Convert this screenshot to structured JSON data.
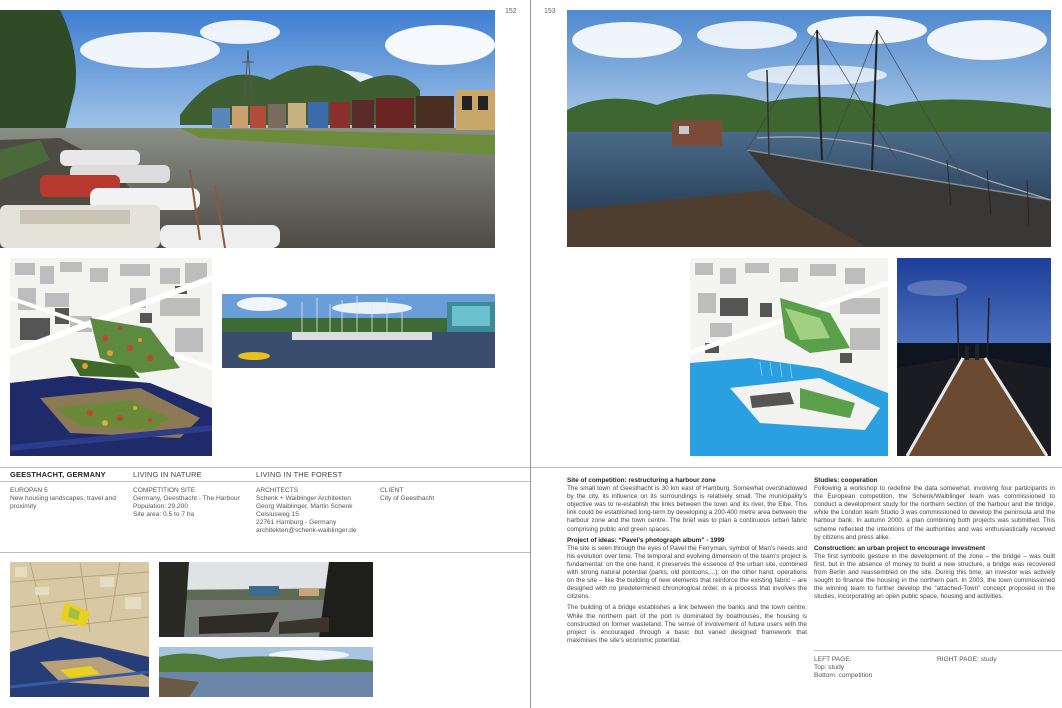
{
  "left_page": {
    "page_number": "152",
    "info": {
      "headers": [
        "GEESTHACHT, GERMANY",
        "LIVING IN NATURE",
        "LIVING IN THE FOREST"
      ],
      "europan": {
        "label": "EUROPAN 5",
        "text": "New housing landscapes, travel and proximity"
      },
      "site": {
        "label": "COMPETITION SITE",
        "lines": [
          "Germany, Geesthacht - The Harbour",
          "Population: 29,200",
          "Site area: 0.5 to 7 ha"
        ]
      },
      "architects": {
        "label": "ARCHITECTS",
        "lines": [
          "Schenk + Waiblinger Architekten",
          "Georg Waiblinger, Martin Schenk",
          "Celsiusweg 15",
          "22761 Hamburg - Germany",
          "architekten@schenk-waiblinger.de"
        ]
      },
      "client": {
        "label": "CLIENT",
        "text": "City of Geesthacht"
      }
    }
  },
  "right_page": {
    "page_number": "153",
    "col1": [
      {
        "heading": "Site of competition: restructuring a harbour zone",
        "paragraphs": [
          "The small town of Geesthacht is 30 km east of Hamburg. Somewhat overshadowed by the city, its influence on its surroundings is relatively small. The municipality’s objective was to re-establish the links between the town and its river, the Elbe. This link could be established long-term by developing a 200-400 metre area between the harbour zone and the town centre. The brief was to plan a continuous urban fabric comprising public and green spaces."
        ]
      },
      {
        "heading": "Project of ideas: “Pavel’s photograph album” - 1999",
        "paragraphs": [
          "The site is seen through the eyes of Pavel the Ferryman, symbol of Man’s needs and his evolution over time. The temporal and evolving dimension of the team’s project is fundamental: on the one hand, it preserves the essence of the urban site, combined with strong natural potential (parks, old pontoons,...); on the other hand, operations on the site – like the building of new elements that reinforce the existing fabric – are designed with no predetermined chronological order, in a process that involves the citizens.",
          "The building of a bridge establishes a link between the banks and the town centre. While the northern part of the port is dominated by boathouses, the housing is constructed on former wasteland. The sense of involvement of future users with the project is encouraged through a basic but varied designed framework that maximises the site’s economic potential."
        ]
      }
    ],
    "col2": [
      {
        "heading": "Studies: cooperation",
        "paragraphs": [
          "Following a workshop to redefine the data somewhat, involving four participants in the European competition, the Schenk/Waiblinger team was commissioned to conduct a development study for the northern section of the harbour and the bridge, while the London team Studio 3 was commissioned to develop the peninsula and the harbour bank. In autumn 2000, a plan combining both projects was submitted. This scheme reflected the intentions of the authorities and was enthusiastically received by citizens and press alike."
        ]
      },
      {
        "heading": "Construction: an urban project to encourage investment",
        "paragraphs": [
          "The first symbolic gesture in the development of the zone – the bridge – was built first, but in the absence of money to build a new structure, a bridge was recovered from Berlin and reassembled on the site. During this time, an investor was actively sought to finance the housing in the northern part. In 2003, the town commissioned the winning team to further develop the “attached-Town” concept proposed in the studies, incorporating an open public space, housing and activities."
        ]
      }
    ],
    "captions": {
      "left_label": "LEFT PAGE:",
      "left_top": "Top: study",
      "left_bottom": "Bottom: competition",
      "right_label": "RIGHT PAGE:",
      "right_text": "study"
    }
  },
  "colors": {
    "water": "#3d4f66",
    "sky": "#6f9fd8",
    "map_blue": "#2aa0e0",
    "green": "#4a7a3a"
  }
}
